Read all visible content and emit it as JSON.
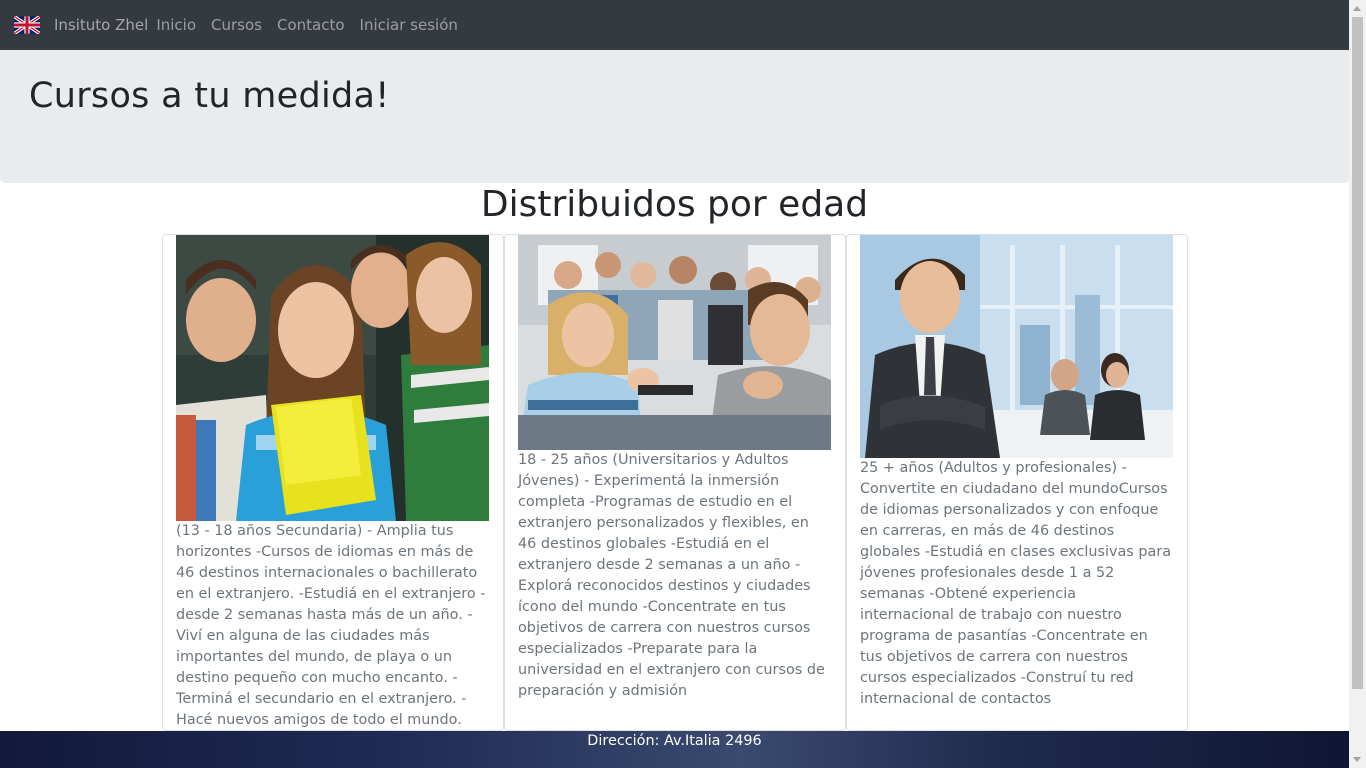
{
  "navbar": {
    "flag_icon": "uk-flag-icon",
    "brand": "Insituto Zhel",
    "links": [
      "Inicio",
      "Cursos",
      "Contacto",
      "Iniciar sesión"
    ]
  },
  "jumbotron": {
    "title": "Cursos a tu medida!"
  },
  "section": {
    "title": "Distribuidos por edad"
  },
  "cards": [
    {
      "image_alt": "teen-students-photo",
      "text": "(13 - 18 años Secundaria) - Amplia tus horizontes -Cursos de idiomas en más de 46 destinos internacionales o bachillerato en el extranjero. -Estudiá en el extranjero - desde 2 semanas hasta más de un año. - Viví en alguna de las ciudades más importantes del mundo, de playa o un destino pequeño con mucho encanto. - Terminá el secundario en el extranjero. - Hacé nuevos amigos de todo el mundo."
    },
    {
      "image_alt": "university-students-photo",
      "text": "18 - 25 años (Universitarios y Adultos Jóvenes) - Experimentá la inmersión completa -Programas de estudio en el extranjero personalizados y flexibles, en 46 destinos globales -Estudiá en el extranjero desde 2 semanas a un año -Explorá reconocidos destinos y ciudades ícono del mundo -Concentrate en tus objetivos de carrera con nuestros cursos especializados -Preparate para la universidad en el extranjero con cursos de preparación y admisión"
    },
    {
      "image_alt": "professional-adult-photo",
      "text": "25 + años (Adultos y profesionales) - Convertite en ciudadano del mundoCursos de idiomas personalizados y con enfoque en carreras, en más de 46 destinos globales -Estudiá en clases exclusivas para jóvenes profesionales desde 1 a 52 semanas -Obtené experiencia internacional de trabajo con nuestro programa de pasantías -Concentrate en tus objetivos de carrera con nuestros cursos especializados -Construí tu red internacional de contactos"
    }
  ],
  "footer": {
    "address": "Dirección: Av.Italia 2496"
  },
  "colors": {
    "navbar_bg": "#343a40",
    "jumbotron_bg": "#e9ecef",
    "muted_text": "#6c757d"
  }
}
